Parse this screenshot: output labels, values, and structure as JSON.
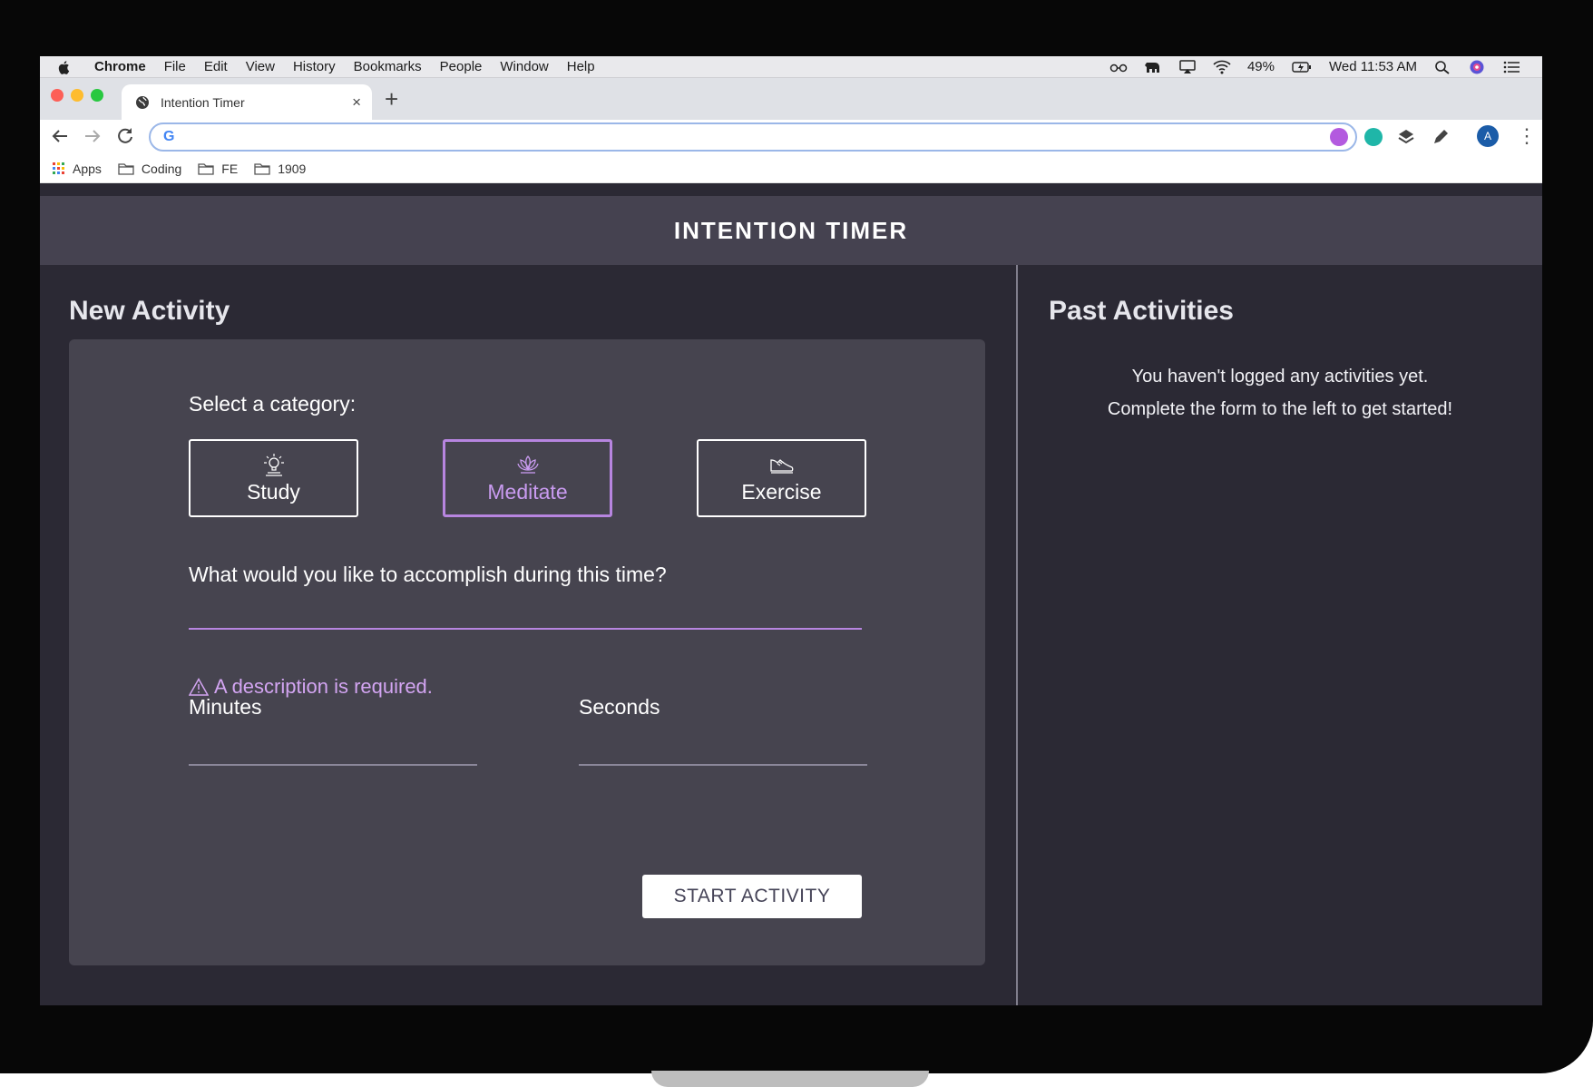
{
  "mac_menubar": {
    "items": [
      "Chrome",
      "File",
      "Edit",
      "View",
      "History",
      "Bookmarks",
      "People",
      "Window",
      "Help"
    ],
    "battery": "49%",
    "clock": "Wed 11:53 AM"
  },
  "browser": {
    "tab_title": "Intention Timer",
    "new_tab_label": "+",
    "close_label": "×",
    "omnibox_value": "",
    "profile_initial": "A",
    "bookmarks": [
      "Apps",
      "Coding",
      "FE",
      "1909"
    ]
  },
  "app": {
    "title": "INTENTION TIMER",
    "new_activity": {
      "heading": "New Activity",
      "category_label": "Select a category:",
      "categories": [
        {
          "label": "Study",
          "icon": "lightbulb-icon",
          "selected": false
        },
        {
          "label": "Meditate",
          "icon": "lotus-icon",
          "selected": true
        },
        {
          "label": "Exercise",
          "icon": "sneaker-icon",
          "selected": false
        }
      ],
      "description_label": "What would you like to accomplish during this time?",
      "description_value": "",
      "error": "A description is required.",
      "minutes_label": "Minutes",
      "minutes_value": "",
      "seconds_label": "Seconds",
      "seconds_value": "",
      "start_button": "START ACTIVITY"
    },
    "past_activities": {
      "heading": "Past Activities",
      "empty_line1": "You haven't logged any activities yet.",
      "empty_line2": "Complete the form to the left to get started!"
    }
  },
  "colors": {
    "header_bg": "#454250",
    "panel_bg": "#2b2934",
    "card_bg": "#46444f",
    "accent_purple": "#b785e0"
  }
}
